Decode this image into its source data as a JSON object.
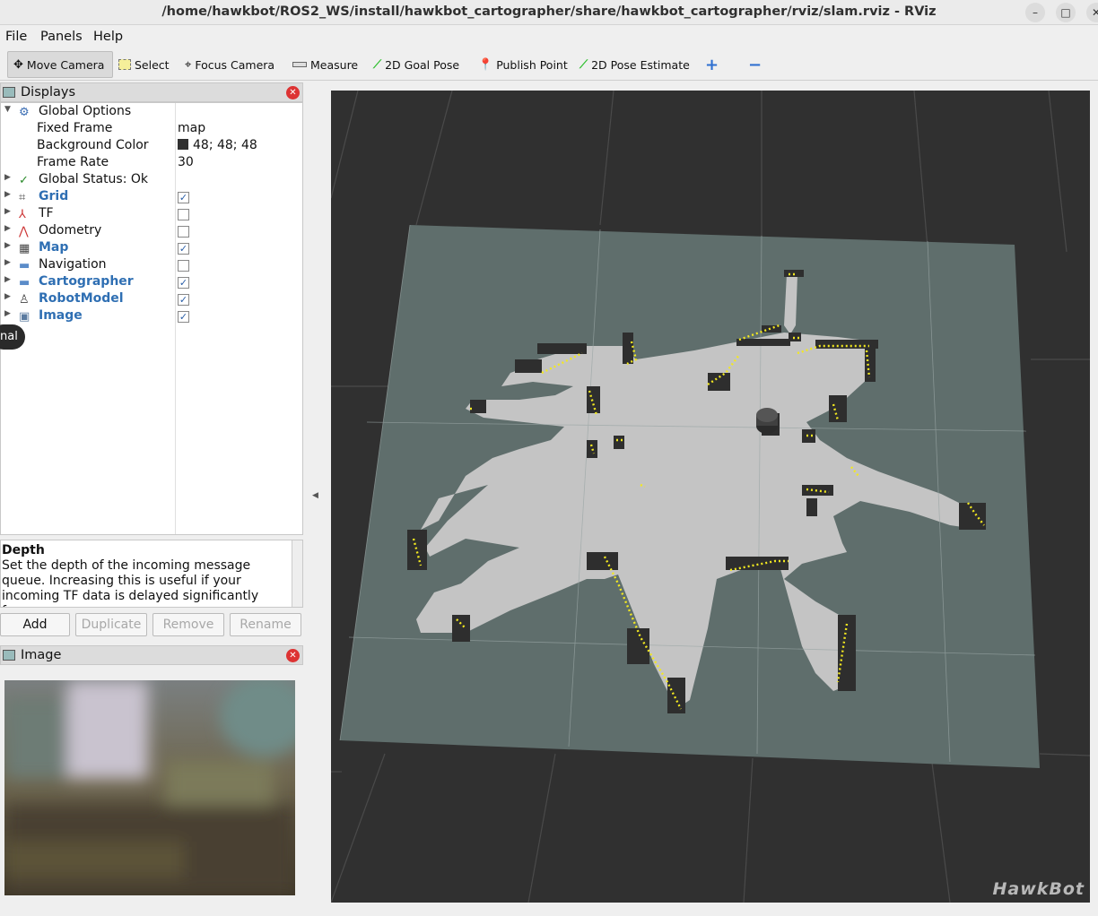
{
  "window": {
    "title": "/home/hawkbot/ROS2_WS/install/hawkbot_cartographer/share/hawkbot_cartographer/rviz/slam.rviz - RViz",
    "minimize": "–",
    "maximize": "□",
    "close": "✕"
  },
  "menu": {
    "file": "File",
    "panels": "Panels",
    "help": "Help"
  },
  "toolbar": {
    "move_camera": "Move Camera",
    "select": "Select",
    "focus_camera": "Focus Camera",
    "measure": "Measure",
    "goal_pose": "2D Goal Pose",
    "publish_point": "Publish Point",
    "pose_estimate": "2D Pose Estimate",
    "add_tool": "+",
    "remove_tool": "−"
  },
  "displays": {
    "title": "Displays",
    "global_options": "Global Options",
    "fixed_frame_label": "Fixed Frame",
    "fixed_frame_value": "map",
    "bg_color_label": "Background Color",
    "bg_color_value": "48; 48; 48",
    "frame_rate_label": "Frame Rate",
    "frame_rate_value": "30",
    "global_status": "Global Status: Ok",
    "items": [
      {
        "label": "Grid",
        "checked": "✓"
      },
      {
        "label": "TF",
        "checked": ""
      },
      {
        "label": "Odometry",
        "checked": ""
      },
      {
        "label": "Map",
        "checked": "✓"
      },
      {
        "label": "Navigation",
        "checked": ""
      },
      {
        "label": "Cartographer",
        "checked": "✓"
      },
      {
        "label": "RobotModel",
        "checked": "✓"
      },
      {
        "label": "Image",
        "checked": "✓"
      }
    ],
    "tooltip_fragment": "nal"
  },
  "help": {
    "title": "Depth",
    "text": "Set the depth of the incoming message queue. Increasing this is useful if your incoming TF data is delayed significantly from your"
  },
  "buttons": {
    "add": "Add",
    "duplicate": "Duplicate",
    "remove": "Remove",
    "rename": "Rename"
  },
  "image_panel": {
    "title": "Image"
  },
  "viewport": {
    "background": "#303030",
    "map_free": "#c4c4c4",
    "map_unknown": "#5f6e6c",
    "scan_color": "#f2e820"
  },
  "watermark": "HawkBot"
}
